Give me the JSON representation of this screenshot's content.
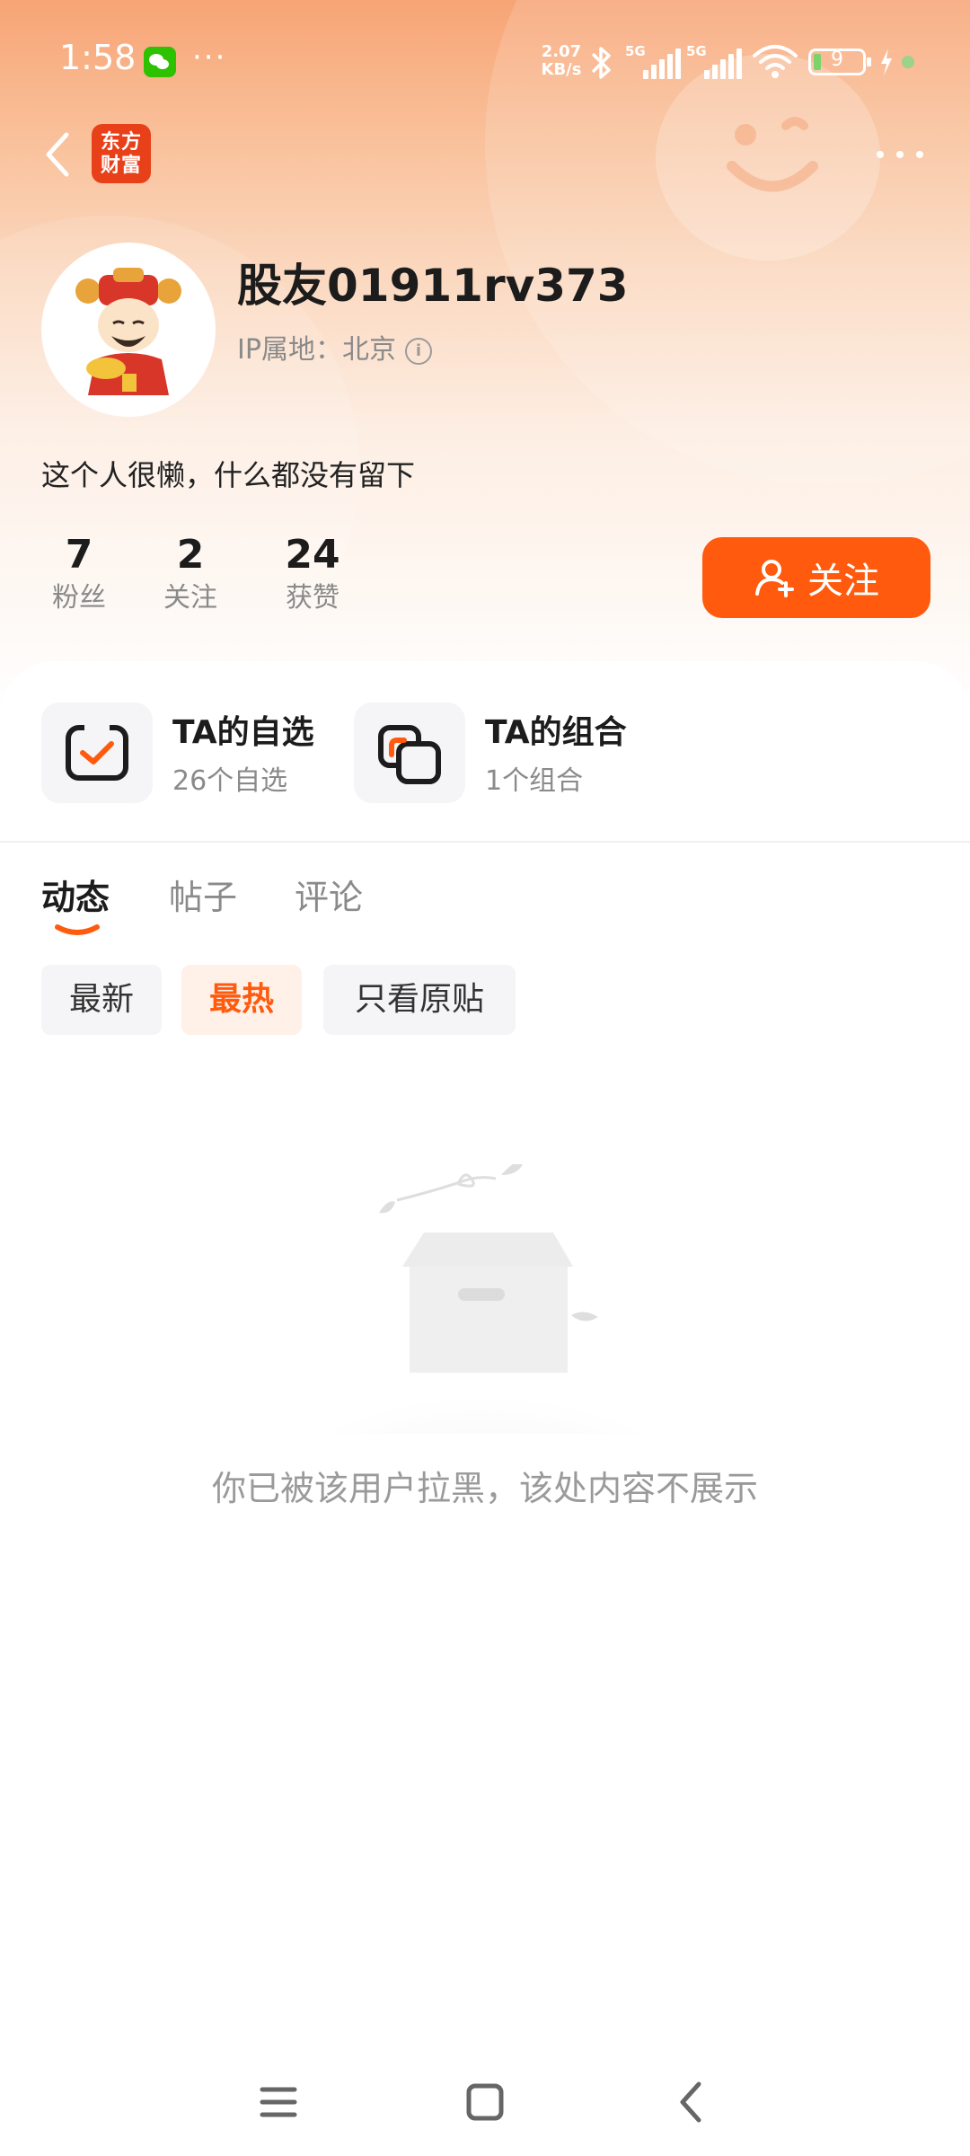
{
  "status_bar": {
    "time": "1:58",
    "more": "···",
    "net_speed_value": "2.07",
    "net_speed_unit": "KB/s",
    "sim1": "5G",
    "sim2": "5G",
    "battery": "9"
  },
  "header": {
    "logo_text_line1": "东方",
    "logo_text_line2": "财富"
  },
  "profile": {
    "username": "股友01911rv373",
    "ip_label": "IP属地：北京",
    "bio": "这个人很懒，什么都没有留下",
    "stats": [
      {
        "value": "7",
        "label": "粉丝"
      },
      {
        "value": "2",
        "label": "关注"
      },
      {
        "value": "24",
        "label": "获赞"
      }
    ],
    "follow_label": "关注"
  },
  "portfolio": [
    {
      "title": "TA的自选",
      "subtitle": "26个自选"
    },
    {
      "title": "TA的组合",
      "subtitle": "1个组合"
    }
  ],
  "tabs": [
    {
      "label": "动态",
      "active": true
    },
    {
      "label": "帖子",
      "active": false
    },
    {
      "label": "评论",
      "active": false
    }
  ],
  "filters": [
    {
      "label": "最新",
      "active": false
    },
    {
      "label": "最热",
      "active": true
    },
    {
      "label": "只看原贴",
      "active": false
    }
  ],
  "empty": {
    "message": "你已被该用户拉黑，该处内容不展示"
  },
  "colors": {
    "accent": "#ff5a0d",
    "brand_logo": "#e8411a"
  }
}
